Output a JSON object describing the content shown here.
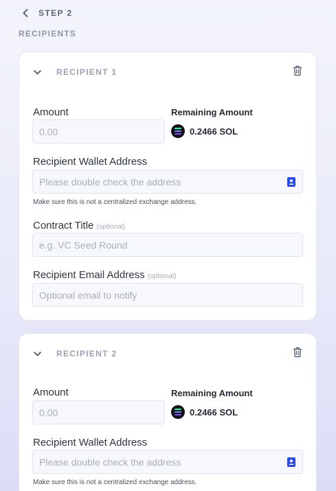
{
  "header": {
    "step_label": "STEP 2",
    "section_label": "RECIPIENTS"
  },
  "recipients": [
    {
      "title": "RECIPIENT 1",
      "amount_label": "Amount",
      "amount_placeholder": "0.00",
      "remaining_label": "Remaining Amount",
      "remaining_value": "0.2466 SOL",
      "wallet_label": "Recipient Wallet Address",
      "wallet_placeholder": "Please double check the address",
      "wallet_hint": "Make sure this is not a centralized exchange address.",
      "contract_label": "Contract Title",
      "contract_optional": "(optional)",
      "contract_placeholder": "e.g. VC Seed Round",
      "email_label": "Recipient Email Address",
      "email_optional": "(optional)",
      "email_placeholder": "Optional email to notify"
    },
    {
      "title": "RECIPIENT 2",
      "amount_label": "Amount",
      "amount_placeholder": "0.00",
      "remaining_label": "Remaining Amount",
      "remaining_value": "0.2466 SOL",
      "wallet_label": "Recipient Wallet Address",
      "wallet_placeholder": "Please double check the address",
      "wallet_hint": "Make sure this is not a centralized exchange address."
    }
  ],
  "icons": {
    "back": "chevron-left-icon",
    "collapse": "chevron-down-icon",
    "delete": "trash-icon",
    "address_book": "address-book-icon",
    "token": "solana-icon"
  },
  "colors": {
    "accent": "#2b4be8",
    "sol_gradient": [
      "#9945ff",
      "#19fb9b"
    ]
  }
}
